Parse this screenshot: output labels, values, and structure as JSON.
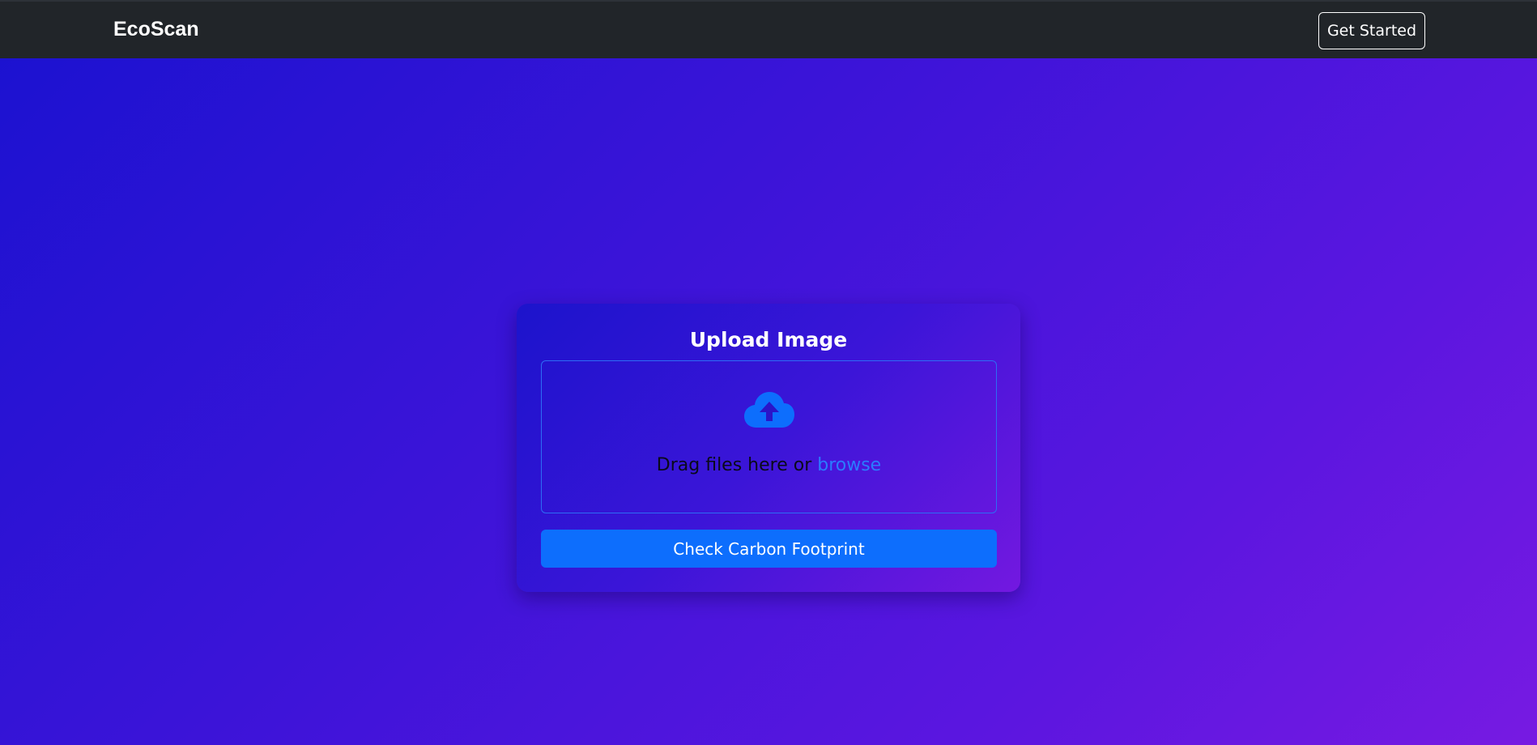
{
  "navbar": {
    "brand": "EcoScan",
    "get_started_label": "Get Started"
  },
  "upload_card": {
    "title": "Upload Image",
    "icon": "cloud-upload-icon",
    "drop_text": "Drag files here or ",
    "browse_label": "browse",
    "submit_label": "Check Carbon Footprint"
  },
  "colors": {
    "navbar_bg": "#212529",
    "accent": "#0d6efd",
    "link": "#2a7cff",
    "gradient_start": "#1a12d0",
    "gradient_end": "#771ae2"
  }
}
